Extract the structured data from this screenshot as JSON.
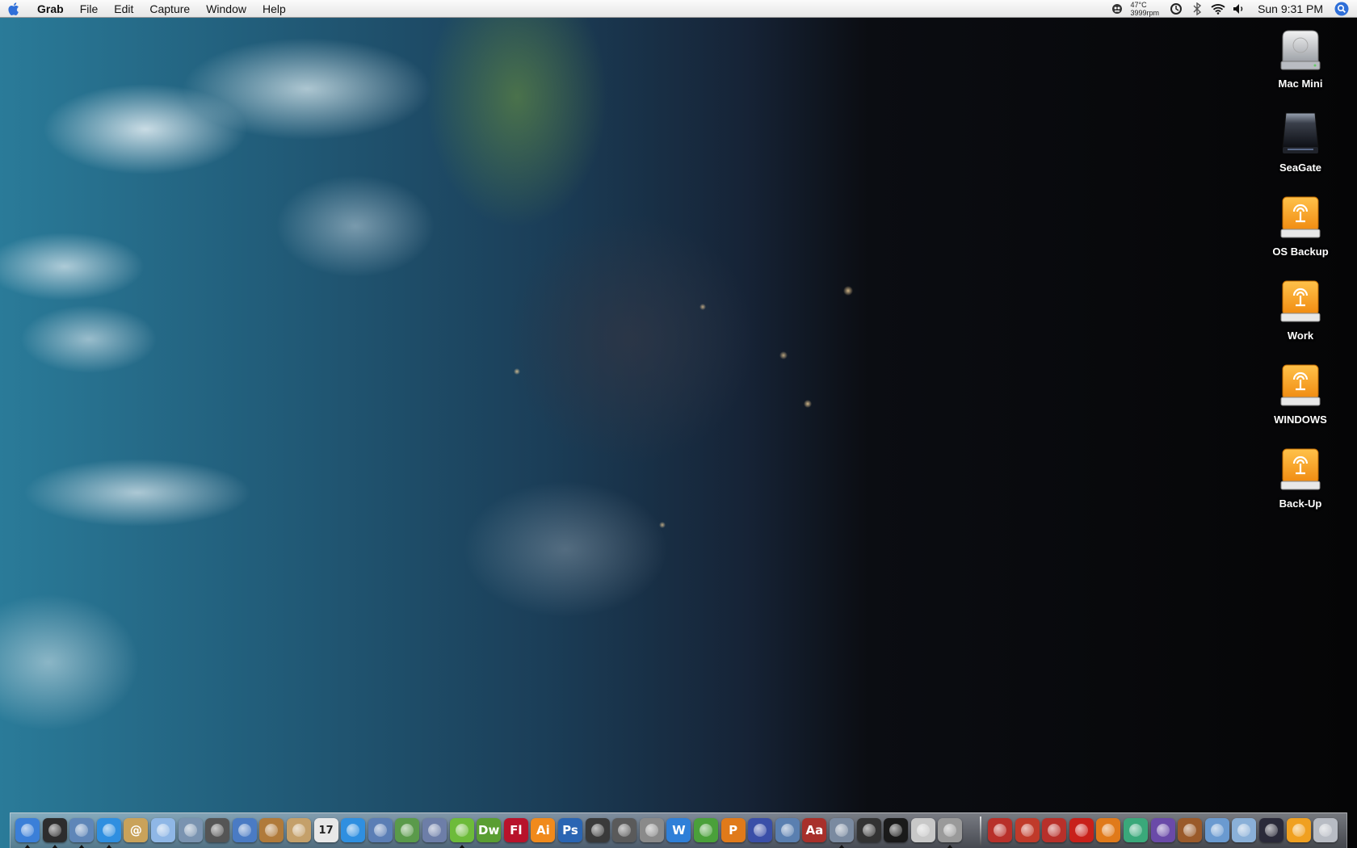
{
  "desktop": {
    "wallpaper": "earth-at-night-wallpaper"
  },
  "menubar": {
    "apple_icon": "apple-icon",
    "app_name": "Grab",
    "items": [
      "File",
      "Edit",
      "Capture",
      "Window",
      "Help"
    ],
    "status": {
      "temperature": "47°C",
      "fan_speed": "3999rpm",
      "clock": "Sun 9:31 PM",
      "icons": [
        "monitor-icon",
        "time-machine-icon",
        "bluetooth-icon",
        "wifi-icon",
        "volume-icon",
        "spotlight-icon"
      ]
    }
  },
  "desktop_icons": [
    {
      "label": "Mac Mini",
      "icon": "internal-hard-drive-icon"
    },
    {
      "label": "SeaGate",
      "icon": "external-drive-icon"
    },
    {
      "label": "OS Backup",
      "icon": "firewire-drive-icon"
    },
    {
      "label": "Work",
      "icon": "firewire-drive-icon"
    },
    {
      "label": "WINDOWS",
      "icon": "firewire-drive-icon"
    },
    {
      "label": "Back-Up",
      "icon": "firewire-drive-icon"
    }
  ],
  "dock": {
    "apps": [
      {
        "icon": "finder-icon",
        "text": "",
        "color": "#3b7fd8"
      },
      {
        "icon": "dashboard-icon",
        "text": "",
        "color": "#2d2d2d"
      },
      {
        "icon": "mail-stamp-icon",
        "text": "",
        "color": "#5f86b8"
      },
      {
        "icon": "safari-icon",
        "text": "",
        "color": "#2f8fe0"
      },
      {
        "icon": "address-book-icon",
        "text": "@",
        "color": "#c9a25a"
      },
      {
        "icon": "itunes-icon",
        "text": "",
        "color": "#8fb7e6"
      },
      {
        "icon": "iphoto-icon",
        "text": "",
        "color": "#7a93b0"
      },
      {
        "icon": "imovie-star-icon",
        "text": "",
        "color": "#555555"
      },
      {
        "icon": "idvd-icon",
        "text": "",
        "color": "#4a7bc4"
      },
      {
        "icon": "garageband-icon",
        "text": "",
        "color": "#b07a3a"
      },
      {
        "icon": "preview-icon",
        "text": "",
        "color": "#c4a06a"
      },
      {
        "icon": "ical-icon",
        "text": "17",
        "color": "#e8e8e8"
      },
      {
        "icon": "quicktime-icon",
        "text": "",
        "color": "#2f8fe0"
      },
      {
        "icon": "keynote-icon",
        "text": "",
        "color": "#5b7eb5"
      },
      {
        "icon": "numbers-icon",
        "text": "",
        "color": "#5a9a4a"
      },
      {
        "icon": "pen-app-icon",
        "text": "",
        "color": "#6d7ea8"
      },
      {
        "icon": "adium-icon",
        "text": "",
        "color": "#6dbb3a"
      },
      {
        "icon": "dreamweaver-icon",
        "text": "Dw",
        "color": "#5a9e32"
      },
      {
        "icon": "flash-icon",
        "text": "Fl",
        "color": "#b8132b"
      },
      {
        "icon": "illustrator-icon",
        "text": "Ai",
        "color": "#f08a1c"
      },
      {
        "icon": "photoshop-icon",
        "text": "Ps",
        "color": "#2a65b3"
      },
      {
        "icon": "final-cut-icon",
        "text": "",
        "color": "#3a3a3a"
      },
      {
        "icon": "clapboard-icon",
        "text": "",
        "color": "#5a5a5a"
      },
      {
        "icon": "automator-icon",
        "text": "",
        "color": "#8a8a8a"
      },
      {
        "icon": "w-app-icon",
        "text": "W",
        "color": "#2f7fd8"
      },
      {
        "icon": "vine-app-icon",
        "text": "",
        "color": "#4aa03a"
      },
      {
        "icon": "p-app-icon",
        "text": "P",
        "color": "#e07a1a"
      },
      {
        "icon": "wizard-icon",
        "text": "",
        "color": "#3a4fa8"
      },
      {
        "icon": "system-profiler-icon",
        "text": "",
        "color": "#5a7fb0"
      },
      {
        "icon": "dictionary-icon",
        "text": "Aa",
        "color": "#a8302a"
      },
      {
        "icon": "photo-app-icon",
        "text": "",
        "color": "#7a8aa0"
      },
      {
        "icon": "console-icon",
        "text": "",
        "color": "#333333"
      },
      {
        "icon": "terminal-icon",
        "text": "",
        "color": "#1a1a1a"
      },
      {
        "icon": "apple-tv-icon",
        "text": "",
        "color": "#c8c8c8"
      },
      {
        "icon": "utility-icon",
        "text": "",
        "color": "#9a9a9a"
      }
    ],
    "docs": [
      {
        "icon": "red-document-icon",
        "text": "",
        "color": "#b8302a"
      },
      {
        "icon": "red-document-icon",
        "text": "",
        "color": "#c03a2a"
      },
      {
        "icon": "red-document-icon",
        "text": "",
        "color": "#b8302a"
      },
      {
        "icon": "demon-mask-icon",
        "text": "",
        "color": "#c8201a"
      },
      {
        "icon": "orange-mask-icon",
        "text": "",
        "color": "#e07a1a"
      },
      {
        "icon": "green-face-icon",
        "text": "",
        "color": "#3aa87a"
      },
      {
        "icon": "purple-face-icon",
        "text": "",
        "color": "#6a4aa8"
      },
      {
        "icon": "brown-document-icon",
        "text": "",
        "color": "#9a5a2a"
      },
      {
        "icon": "applications-folder-icon",
        "text": "",
        "color": "#6a9ad0"
      },
      {
        "icon": "documents-folder-icon",
        "text": "",
        "color": "#8ab0d8"
      },
      {
        "icon": "drive-stack-icon",
        "text": "",
        "color": "#2a2a3a"
      },
      {
        "icon": "firewire-stack-icon",
        "text": "",
        "color": "#f0a020"
      },
      {
        "icon": "trash-icon",
        "text": "",
        "color": "#b8bcc4"
      }
    ]
  },
  "colors": {
    "menubar_text": "#111111",
    "drive_orange": "#f5a623",
    "label_text": "#ffffff"
  }
}
